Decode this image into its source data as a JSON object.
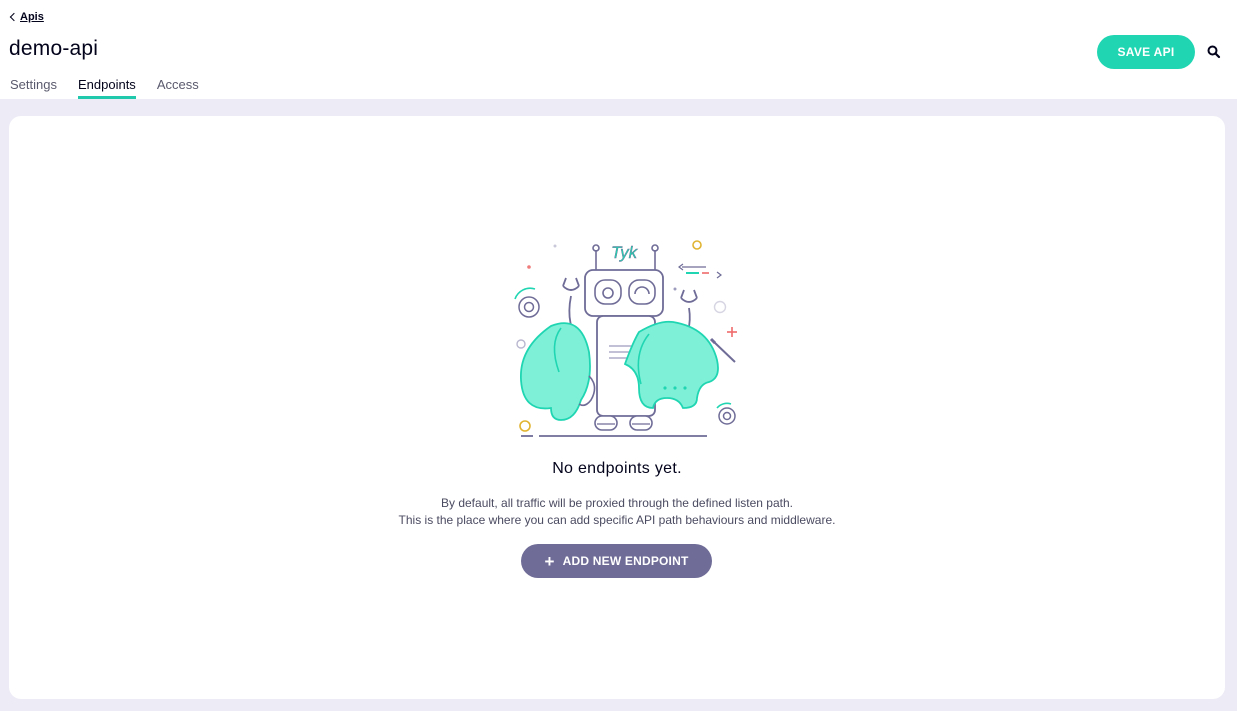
{
  "header": {
    "back_label": "Apis",
    "title": "demo-api",
    "save_label": "SAVE API",
    "search_icon": "search-icon"
  },
  "tabs": [
    {
      "label": "Settings",
      "active": false
    },
    {
      "label": "Endpoints",
      "active": true
    },
    {
      "label": "Access",
      "active": false
    }
  ],
  "empty_state": {
    "illustration_text": "Tyk",
    "title": "No endpoints yet.",
    "description_line1": "By default, all traffic will be proxied through the defined listen path.",
    "description_line2": "This is the place where you can add specific API path behaviours and middleware.",
    "add_button_label": "ADD NEW ENDPOINT"
  },
  "colors": {
    "accent": "#20d6b2",
    "secondary_button": "#6f6c97",
    "background": "#ecebf6",
    "illustration_mint": "#7ff0d8",
    "illustration_outline": "#6f6c97"
  }
}
